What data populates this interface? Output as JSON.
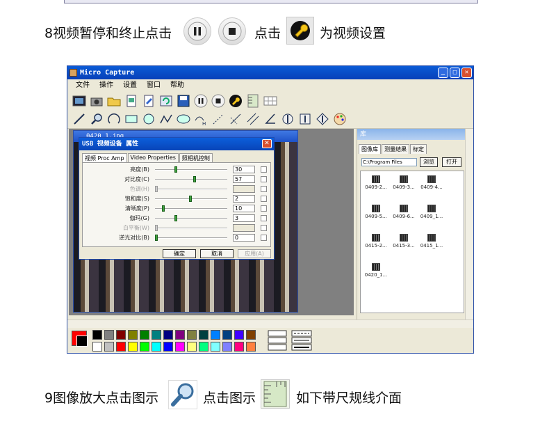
{
  "step8": {
    "text_a": "8视频暂停和终止点击",
    "text_b": "点击",
    "text_c": "为视频设置",
    "icons": [
      "pause-icon",
      "stop-icon",
      "wrench-settings-icon"
    ]
  },
  "step9": {
    "text_a": "9图像放大点击图示",
    "text_b": "点击图示",
    "text_c": "如下带尺规线介面",
    "icons": [
      "magnifier-icon",
      "ruler-icon"
    ]
  },
  "app": {
    "title": "Micro Capture",
    "menu": [
      "文件",
      "操作",
      "设置",
      "窗口",
      "帮助"
    ],
    "inner_title": "0420_1.jpg"
  },
  "dialog": {
    "title": "USB 视频设备 属性",
    "tabs": [
      "视频 Proc Amp",
      "Video Properties",
      "照相机控制"
    ],
    "rows": [
      {
        "label": "亮度(B)",
        "value": "30",
        "level": 0.28,
        "disabled": false
      },
      {
        "label": "对比度(C)",
        "value": "57",
        "level": 0.55,
        "disabled": false
      },
      {
        "label": "色调(H)",
        "value": "",
        "level": 0.0,
        "disabled": true
      },
      {
        "label": "饱和度(S)",
        "value": "2",
        "level": 0.49,
        "disabled": false
      },
      {
        "label": "清晰度(P)",
        "value": "10",
        "level": 0.1,
        "disabled": false
      },
      {
        "label": "伽玛(G)",
        "value": "3",
        "level": 0.28,
        "disabled": false
      },
      {
        "label": "白平衡(W)",
        "value": "",
        "level": 0.0,
        "disabled": true
      },
      {
        "label": "逆光对比(B)",
        "value": "0",
        "level": 0.0,
        "disabled": false
      }
    ],
    "buttons": {
      "ok": "确定",
      "cancel": "取消",
      "apply": "应用(A)"
    }
  },
  "library": {
    "title": "库",
    "tabs": [
      "图像库",
      "测量结果",
      "标定"
    ],
    "path": "C:\\Program Files",
    "browse": "浏览",
    "open": "打开",
    "thumbs": [
      "0409-2...",
      "0409-3...",
      "0409-4...",
      "0409-5...",
      "0409-6...",
      "0409_1...",
      "0415-2...",
      "0415-3...",
      "0415_1...",
      "0420_1..."
    ]
  },
  "colors": {
    "palette_top": [
      "#000000",
      "#808080",
      "#800000",
      "#808000",
      "#008000",
      "#008080",
      "#000080",
      "#800080",
      "#808040",
      "#004040",
      "#0080ff",
      "#004080",
      "#4000ff",
      "#804000"
    ],
    "palette_bottom": [
      "#ffffff",
      "#c0c0c0",
      "#ff0000",
      "#ffff00",
      "#00ff00",
      "#00ffff",
      "#0000ff",
      "#ff00ff",
      "#ffff80",
      "#00ff80",
      "#80ffff",
      "#8080ff",
      "#ff0080",
      "#ff8040"
    ]
  }
}
